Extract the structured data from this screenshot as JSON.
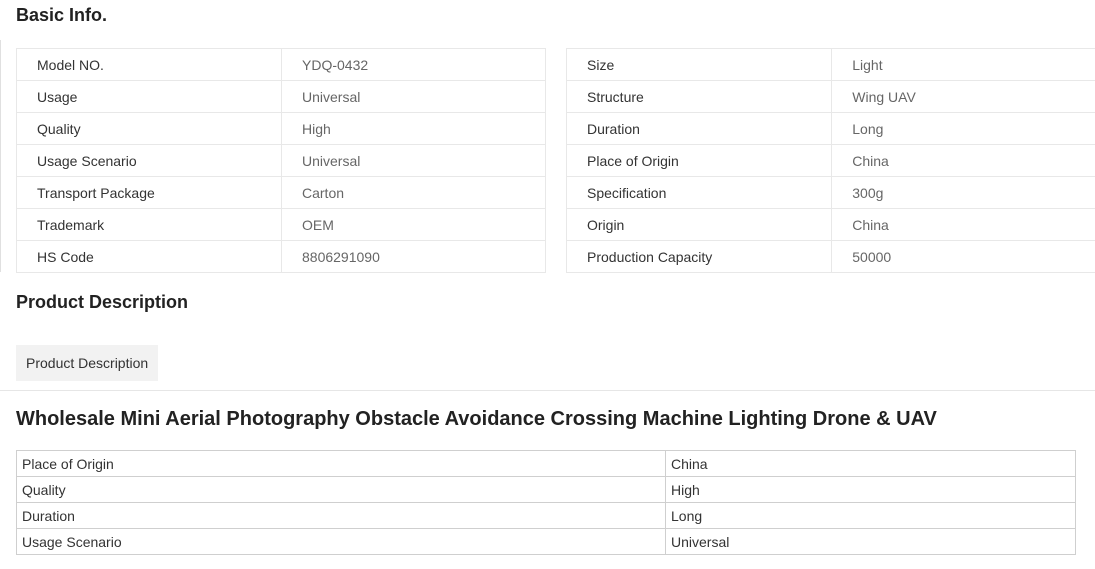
{
  "basic_info": {
    "title": "Basic Info.",
    "left": [
      {
        "key": "Model NO.",
        "value": "YDQ-0432"
      },
      {
        "key": "Usage",
        "value": "Universal"
      },
      {
        "key": "Quality",
        "value": "High"
      },
      {
        "key": "Usage Scenario",
        "value": "Universal"
      },
      {
        "key": "Transport Package",
        "value": "Carton"
      },
      {
        "key": "Trademark",
        "value": "OEM"
      },
      {
        "key": "HS Code",
        "value": "8806291090"
      }
    ],
    "right": [
      {
        "key": "Size",
        "value": "Light"
      },
      {
        "key": "Structure",
        "value": "Wing UAV"
      },
      {
        "key": "Duration",
        "value": "Long"
      },
      {
        "key": "Place of Origin",
        "value": "China"
      },
      {
        "key": "Specification",
        "value": "300g"
      },
      {
        "key": "Origin",
        "value": "China"
      },
      {
        "key": "Production Capacity",
        "value": "50000"
      }
    ]
  },
  "product_description": {
    "title": "Product Description",
    "tab_label": "Product Description",
    "product_title": "Wholesale Mini Aerial Photography Obstacle Avoidance Crossing Machine Lighting Drone & UAV",
    "specs": [
      {
        "key": "Place of Origin",
        "value": "China"
      },
      {
        "key": "Quality",
        "value": "High"
      },
      {
        "key": "Duration",
        "value": "Long"
      },
      {
        "key": "Usage Scenario",
        "value": "Universal"
      }
    ]
  }
}
